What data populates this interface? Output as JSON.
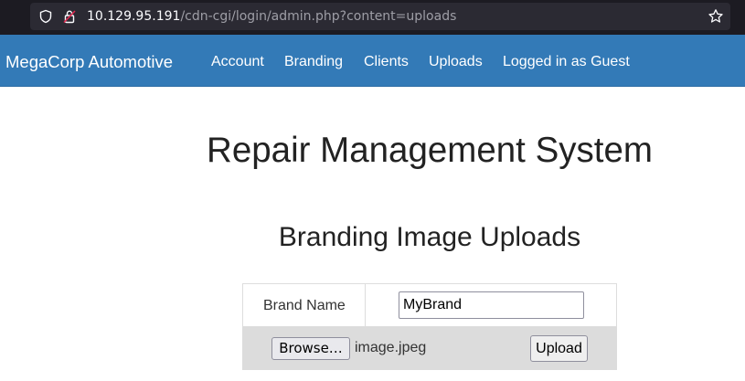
{
  "browser": {
    "url_host": "10.129.95.191",
    "url_path": "/cdn-cgi/login/admin.php?content=uploads",
    "icons": {
      "shield": "shield-icon",
      "lock": "insecure-lock-icon",
      "bookmark": "star-icon"
    }
  },
  "navbar": {
    "brand": "MegaCorp Automotive",
    "links": [
      "Account",
      "Branding",
      "Clients",
      "Uploads",
      "Logged in as Guest"
    ],
    "background": "#337ab7"
  },
  "main": {
    "title": "Repair Management System",
    "subtitle": "Branding Image Uploads",
    "form": {
      "brand_label": "Brand Name",
      "brand_value": "MyBrand",
      "browse_label": "Browse…",
      "file_name": "image.jpeg",
      "upload_label": "Upload"
    }
  }
}
